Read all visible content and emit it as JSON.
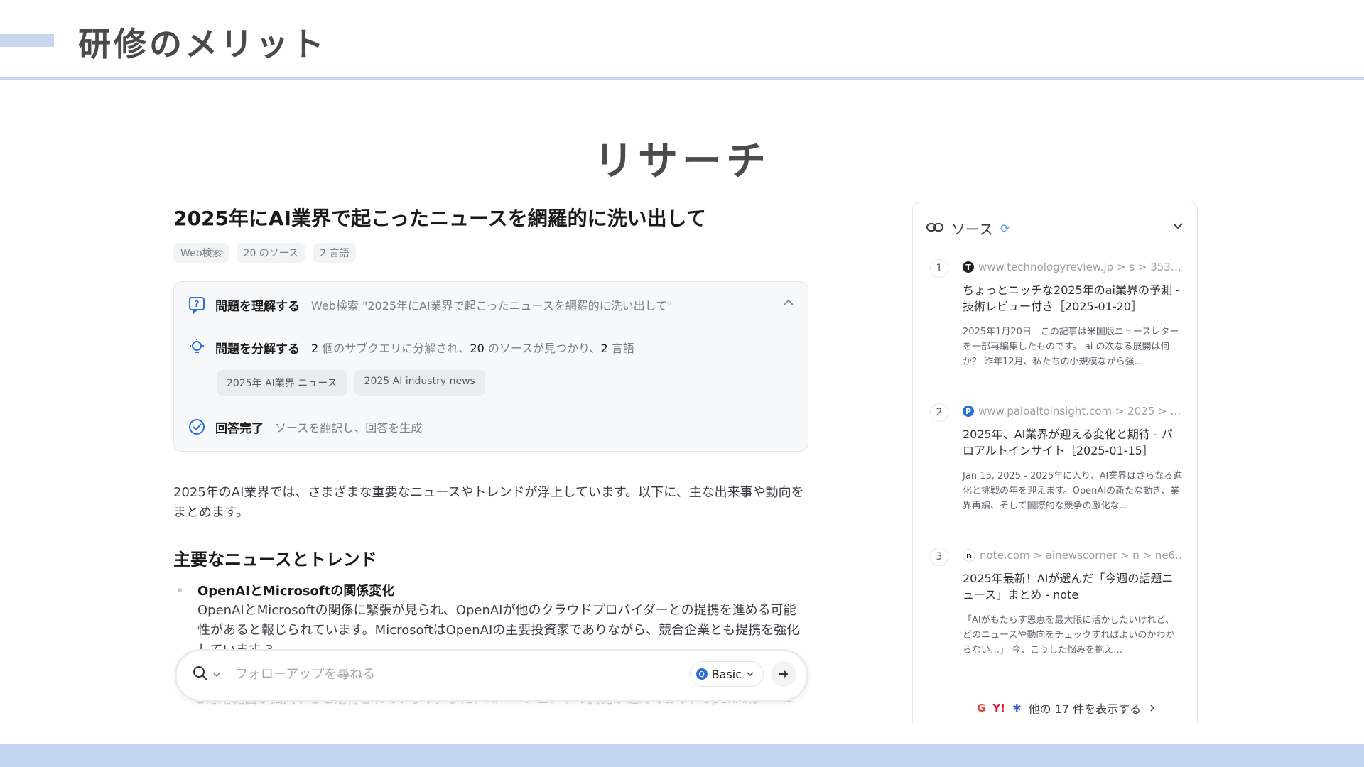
{
  "slide": {
    "title": "研修のメリット",
    "section": "リサーチ"
  },
  "query": {
    "title": "2025年にAI業界で起こったニュースを網羅的に洗い出して",
    "tags": [
      "Web検索",
      "20 のソース",
      "2 言語"
    ]
  },
  "steps": {
    "understand": {
      "label": "問題を理解する",
      "detail": "Web検索 \"2025年にAI業界で起こったニュースを網羅的に洗い出して\""
    },
    "decompose": {
      "label": "問題を分解する",
      "count1": "2",
      "text1": "個のサブクエリに分解され、",
      "count2": "20",
      "text2": "のソースが見つかり、",
      "count3": "2",
      "text3": "言語"
    },
    "subqueries": [
      "2025年 AI業界 ニュース",
      "2025 AI industry news"
    ],
    "done": {
      "label": "回答完了",
      "detail": "ソースを翻訳し、回答を生成"
    }
  },
  "answer": {
    "intro": "2025年のAI業界では、さまざまな重要なニュースやトレンドが浮上しています。以下に、主な出来事や動向をまとめます。",
    "heading": "主要なニュースとトレンド",
    "bullet_title": "OpenAIとMicrosoftの関係変化",
    "bullet_text": "OpenAIとMicrosoftの関係に緊張が見られ、OpenAIが他のクラウドプロバイダーとの提携を進める可能性があると報じられています。MicrosoftはOpenAIの主要投資家でありながら、競合企業とも提携を強化しています 3",
    "faded": "と応用範囲が拡大すると期待されています。また、AIエージェントの開発が進んでおり、OpenAIは",
    "faded_tail": "任"
  },
  "followup": {
    "placeholder": "フォローアップを尋ねる",
    "mode": "Basic"
  },
  "sources": {
    "title": "ソース",
    "items": [
      {
        "num": "1",
        "url": "www.technologyreview.jp > s > 353…",
        "title": "ちょっとニッチな2025年のai業界の予測 - 技術レビュー付き［2025-01-20］",
        "snippet": "2025年1月20日 - この記事は米国版ニュースレターを一部再編集したものです。 ai の次なる展開は何か？ 昨年12月、私たちの小規模ながら強…"
      },
      {
        "num": "2",
        "url": "www.paloaltoinsight.com > 2025 > …",
        "title": "2025年、AI業界が迎える変化と期待 - パロアルトインサイト［2025-01-15］",
        "snippet": "Jan 15, 2025 - 2025年に入り、AI業界はさらなる進化と挑戦の年を迎えます。OpenAIの新たな動き、業界再編、そして国際的な競争の激化な…"
      },
      {
        "num": "3",
        "url": "note.com > ainewscorner > n > ne6…",
        "title": "2025年最新！AIが選んだ「今週の話題ニュース」まとめ - note",
        "snippet": "「AIがもたらす恩恵を最大限に活かしたいけれど、どのニュースや動向をチェックすればよいのかわからない…」 今、こうした悩みを抱え…"
      }
    ],
    "more": "他の 17 件を表示する"
  }
}
